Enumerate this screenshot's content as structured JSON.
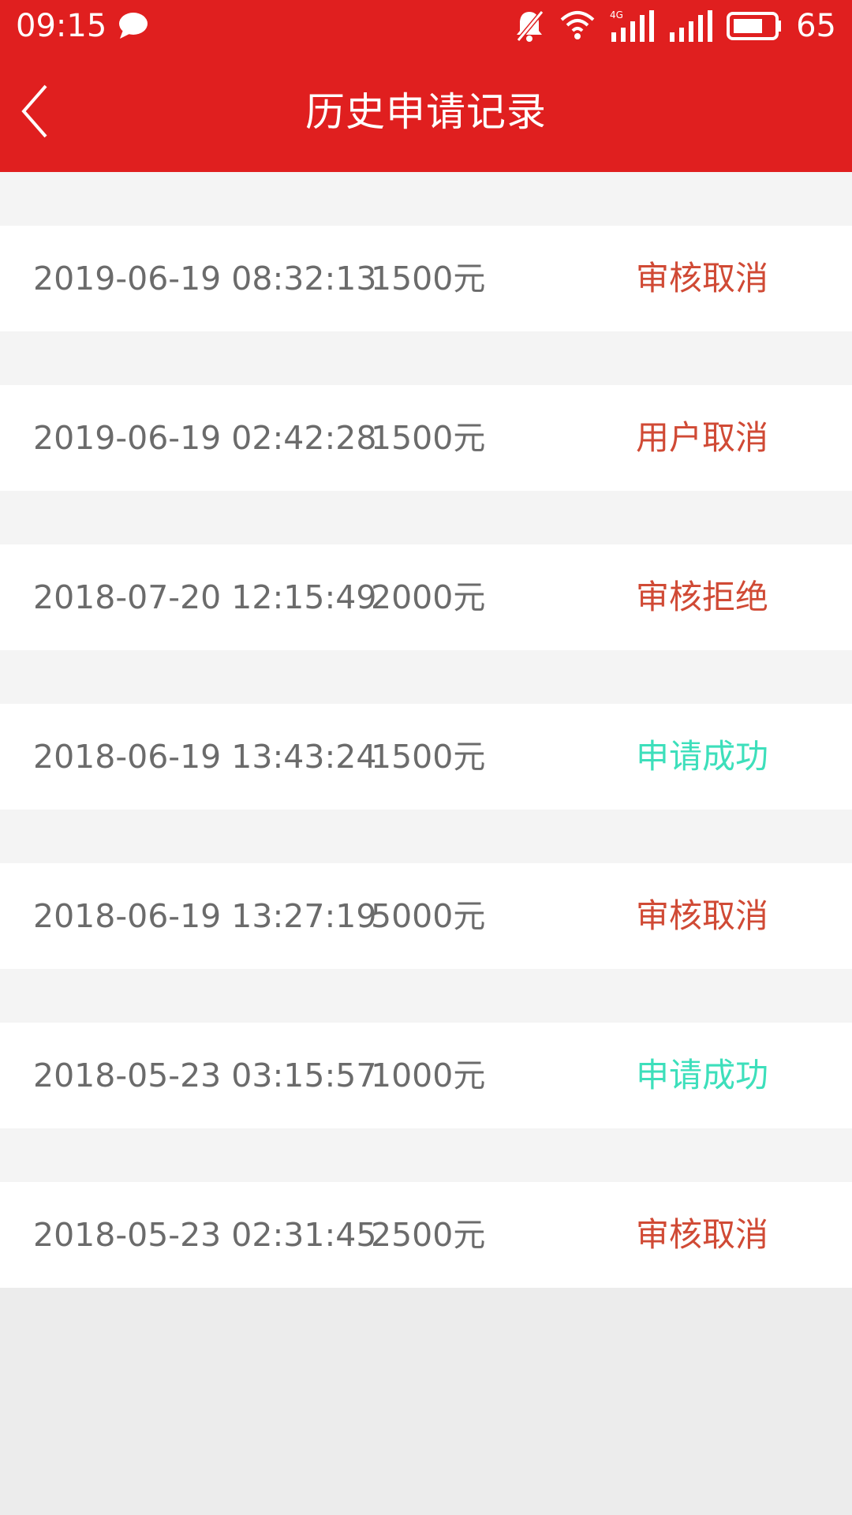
{
  "status_bar": {
    "time": "09:15",
    "battery": "65",
    "icons": [
      "chat-bubble-icon",
      "bell-muted-icon",
      "wifi-icon",
      "signal-4g-icon",
      "signal-icon",
      "battery-icon"
    ]
  },
  "header": {
    "title": "历史申请记录",
    "back_icon": "chevron-left-icon",
    "background_color": "#e01f1f"
  },
  "records": [
    {
      "time": "2019-06-19 08:32:13",
      "amount": "1500元",
      "status": "审核取消",
      "status_color": "#d04a35"
    },
    {
      "time": "2019-06-19 02:42:28",
      "amount": "1500元",
      "status": "用户取消",
      "status_color": "#d04a35"
    },
    {
      "time": "2018-07-20 12:15:49",
      "amount": "2000元",
      "status": "审核拒绝",
      "status_color": "#d04a35"
    },
    {
      "time": "2018-06-19 13:43:24",
      "amount": "1500元",
      "status": "申请成功",
      "status_color": "#3ddfbb"
    },
    {
      "time": "2018-06-19 13:27:19",
      "amount": "5000元",
      "status": "审核取消",
      "status_color": "#d04a35"
    },
    {
      "time": "2018-05-23 03:15:57",
      "amount": "1000元",
      "status": "申请成功",
      "status_color": "#3ddfbb"
    },
    {
      "time": "2018-05-23 02:31:45",
      "amount": "2500元",
      "status": "审核取消",
      "status_color": "#d04a35"
    }
  ]
}
